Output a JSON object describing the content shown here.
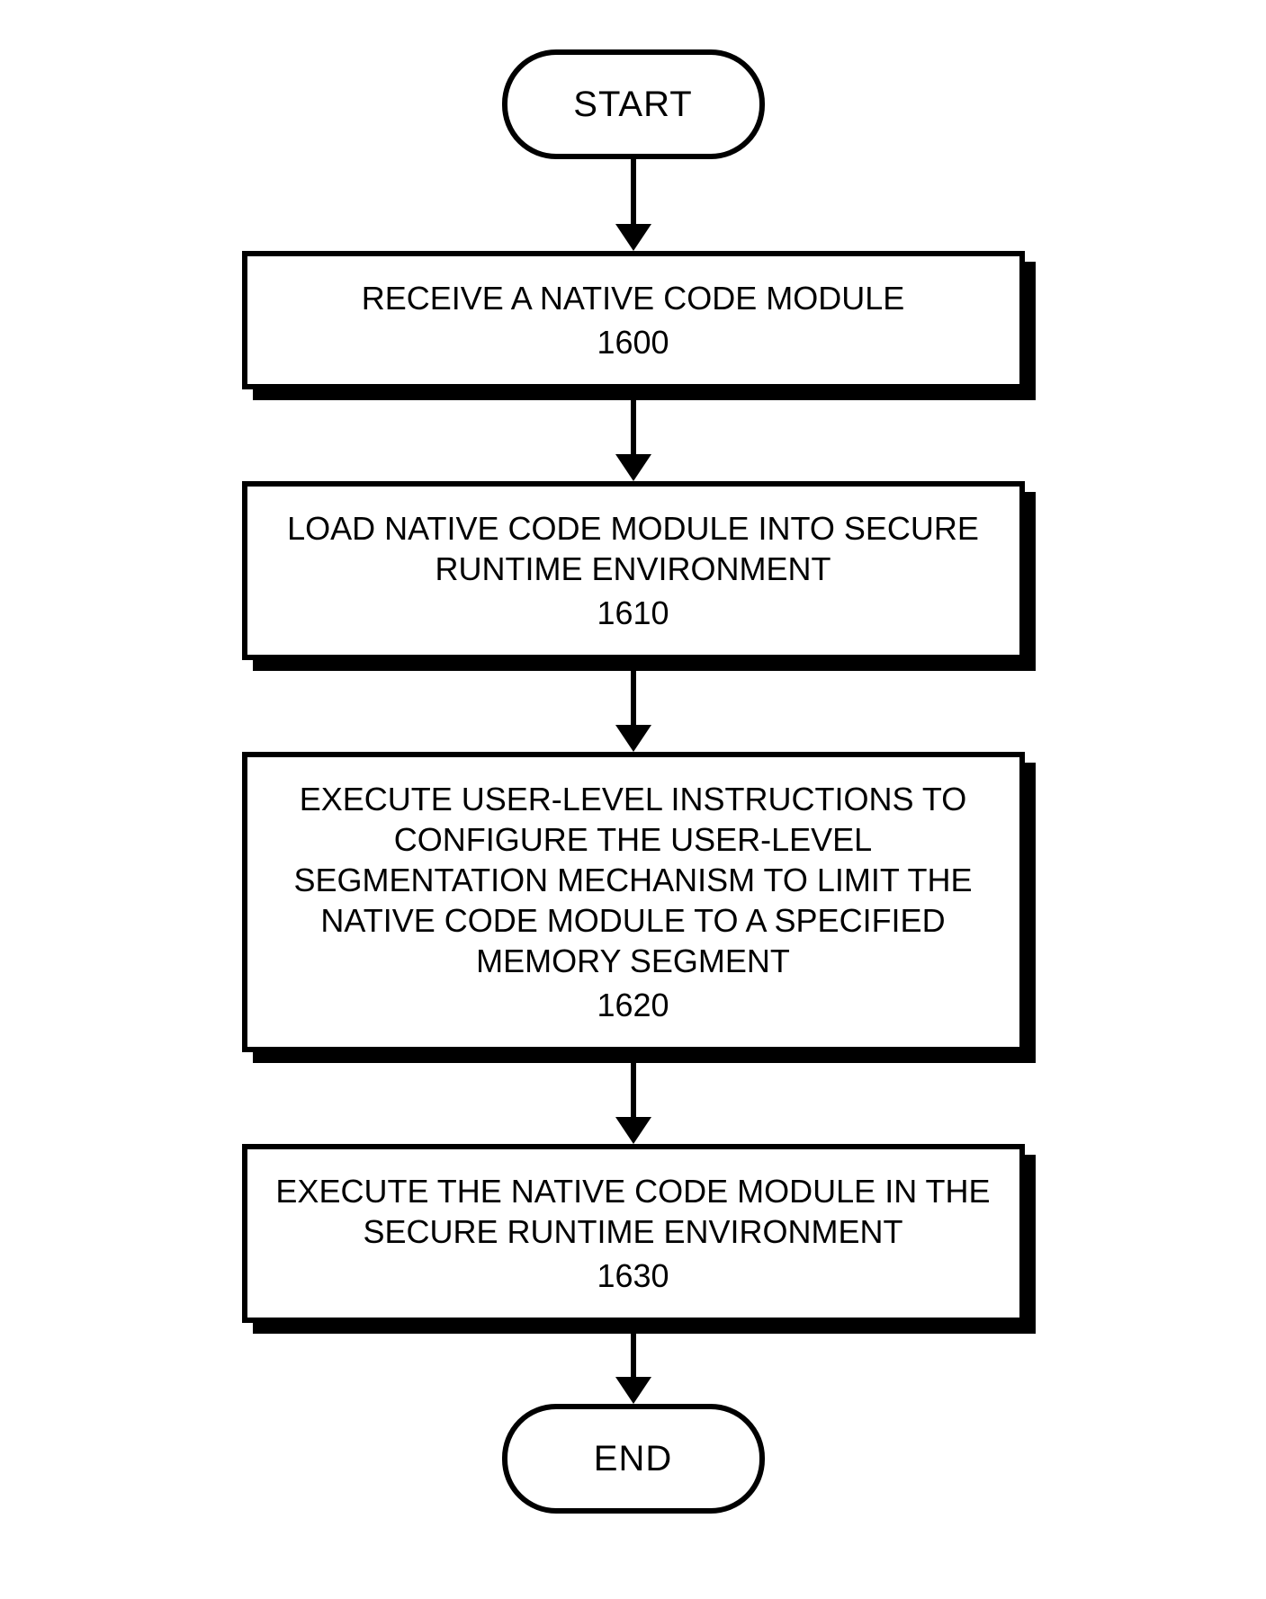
{
  "terminators": {
    "start": "START",
    "end": "END"
  },
  "steps": [
    {
      "text": "RECEIVE A NATIVE CODE MODULE",
      "ref": "1600"
    },
    {
      "text": "LOAD NATIVE CODE MODULE INTO SECURE RUNTIME ENVIRONMENT",
      "ref": "1610"
    },
    {
      "text": "EXECUTE USER-LEVEL INSTRUCTIONS TO CONFIGURE THE USER-LEVEL SEGMENTATION MECHANISM TO LIMIT THE NATIVE CODE MODULE TO A SPECIFIED MEMORY SEGMENT",
      "ref": "1620"
    },
    {
      "text": "EXECUTE THE NATIVE CODE MODULE IN THE SECURE RUNTIME ENVIRONMENT",
      "ref": "1630"
    }
  ]
}
